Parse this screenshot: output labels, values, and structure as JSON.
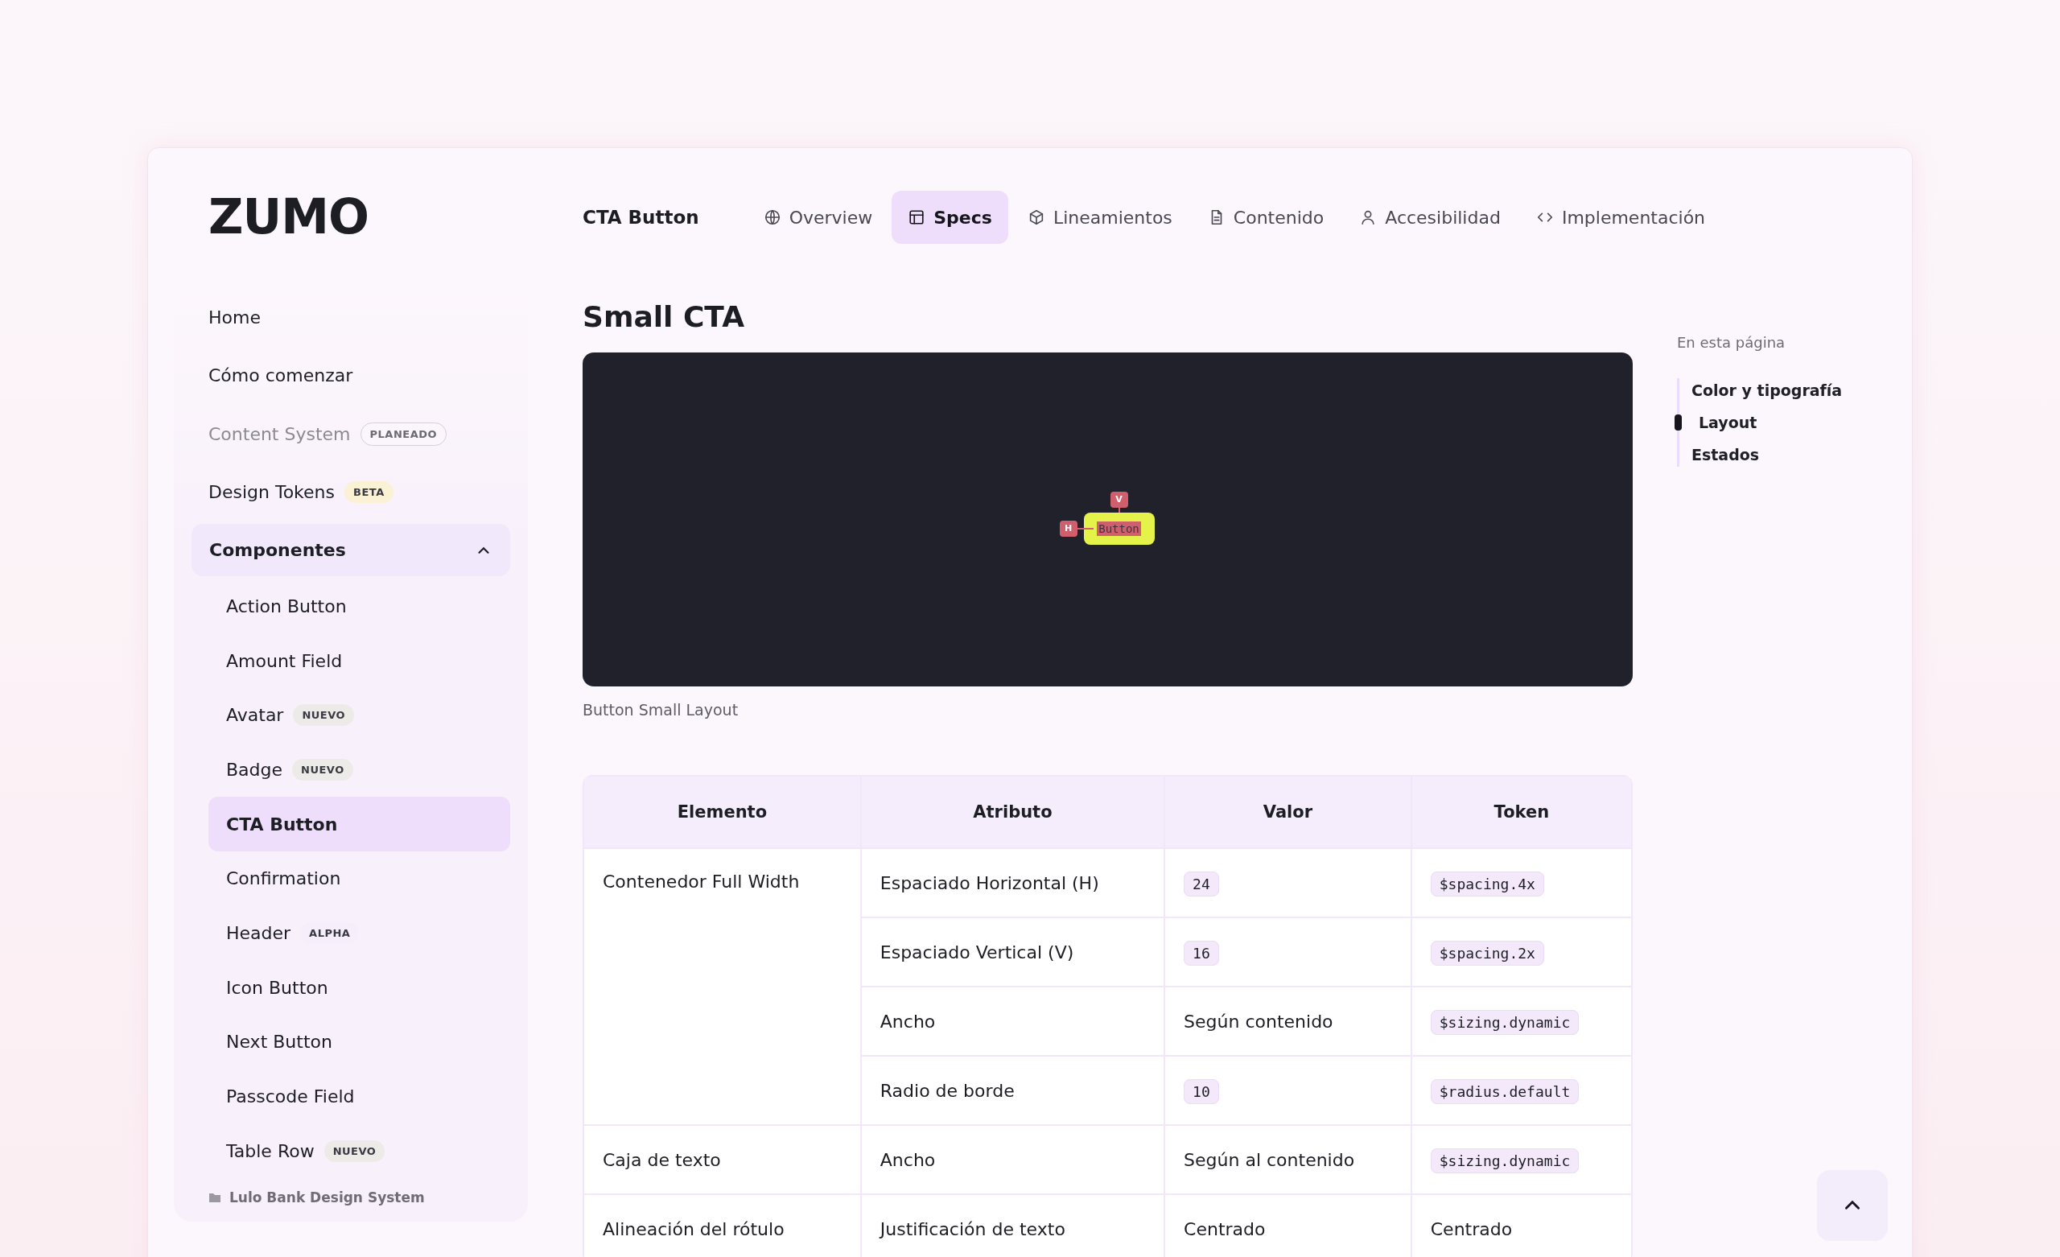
{
  "logo": "ZUMO",
  "sidebar": {
    "items": [
      {
        "label": "Home",
        "disabled": false
      },
      {
        "label": "Cómo comenzar",
        "disabled": false
      },
      {
        "label": "Content System",
        "disabled": true,
        "badge": {
          "text": "PLANEADO",
          "color": "#fbf6fb"
        }
      },
      {
        "label": "Design Tokens",
        "disabled": false,
        "badge": {
          "text": "BETA",
          "color": "#fbf1d4"
        }
      }
    ],
    "group": {
      "label": "Componentes",
      "expanded": true,
      "children": [
        {
          "label": "Action Button",
          "selected": false
        },
        {
          "label": "Amount Field",
          "selected": false
        },
        {
          "label": "Avatar",
          "selected": false,
          "badge": {
            "text": "NUEVO",
            "color": "#ecebe8"
          }
        },
        {
          "label": "Badge",
          "selected": false,
          "badge": {
            "text": "NUEVO",
            "color": "#ecebe8"
          }
        },
        {
          "label": "CTA Button",
          "selected": true
        },
        {
          "label": "Confirmation",
          "selected": false
        },
        {
          "label": "Header",
          "selected": false,
          "badge": {
            "text": "ALPHA",
            "color": "#f6eefa"
          }
        },
        {
          "label": "Icon Button",
          "selected": false
        },
        {
          "label": "Next Button",
          "selected": false
        },
        {
          "label": "Passcode Field",
          "selected": false
        },
        {
          "label": "Table Row",
          "selected": false,
          "badge": {
            "text": "NUEVO",
            "color": "#ecebe8"
          }
        }
      ]
    },
    "footer": "Lulo Bank Design System"
  },
  "header": {
    "title": "CTA Button",
    "tabs": [
      {
        "label": "Overview",
        "selected": false
      },
      {
        "label": "Specs",
        "selected": true
      },
      {
        "label": "Lineamientos",
        "selected": false
      },
      {
        "label": "Contenido",
        "selected": false
      },
      {
        "label": "Accesibilidad",
        "selected": false
      },
      {
        "label": "Implementación",
        "selected": false
      }
    ]
  },
  "heading": "Small CTA",
  "preview": {
    "button_label": "Button",
    "horizontal_marker": "H",
    "vertical_marker": "V",
    "caption": "Button Small Layout"
  },
  "table": {
    "columns": [
      "Elemento",
      "Atributo",
      "Valor",
      "Token"
    ],
    "groups": [
      {
        "element": "Contenedor Full Width",
        "rows": [
          {
            "attribute": "Espaciado Horizontal (H)",
            "value": {
              "kind": "code",
              "text": "24"
            },
            "token": {
              "kind": "code",
              "text": "$spacing.4x"
            }
          },
          {
            "attribute": "Espaciado Vertical (V)",
            "value": {
              "kind": "code",
              "text": "16"
            },
            "token": {
              "kind": "code",
              "text": "$spacing.2x"
            }
          },
          {
            "attribute": "Ancho",
            "value": {
              "kind": "text",
              "text": "Según contenido"
            },
            "token": {
              "kind": "code",
              "text": "$sizing.dynamic"
            }
          },
          {
            "attribute": "Radio de borde",
            "value": {
              "kind": "code",
              "text": "10"
            },
            "token": {
              "kind": "code",
              "text": "$radius.default"
            }
          }
        ]
      },
      {
        "element": "Caja de texto",
        "rows": [
          {
            "attribute": "Ancho",
            "value": {
              "kind": "text",
              "text": "Según al contenido"
            },
            "token": {
              "kind": "code",
              "text": "$sizing.dynamic"
            }
          }
        ]
      },
      {
        "element": "Alineación del rótulo",
        "rows": [
          {
            "attribute": "Justificación de texto",
            "value": {
              "kind": "text",
              "text": "Centrado"
            },
            "token": {
              "kind": "text",
              "text": "Centrado"
            }
          }
        ]
      }
    ]
  },
  "toc": {
    "title": "En esta página",
    "items": [
      {
        "label": "Color y tipografía",
        "selected": false
      },
      {
        "label": "Layout",
        "selected": true
      },
      {
        "label": "Estados",
        "selected": false
      }
    ]
  }
}
